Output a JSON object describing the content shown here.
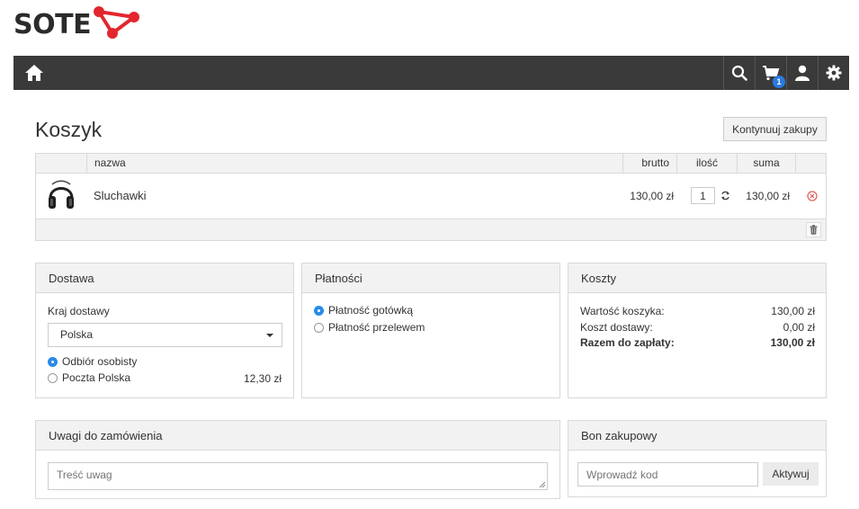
{
  "brand": {
    "name": "SOTE",
    "accent": "#e3262e"
  },
  "nav": {
    "home_icon": "home-icon",
    "search_icon": "search-icon",
    "cart_icon": "cart-icon",
    "cart_count": "1",
    "user_icon": "user-icon",
    "settings_icon": "gear-icon",
    "bg": "#3a3a3a"
  },
  "page": {
    "title": "Koszyk",
    "continue_label": "Kontynuuj zakupy"
  },
  "cart": {
    "columns": {
      "name": "nazwa",
      "brutto": "brutto",
      "qty": "ilość",
      "sum": "suma"
    },
    "items": [
      {
        "icon": "headphones-icon",
        "name": "Sluchawki",
        "brutto": "130,00 zł",
        "qty": "1",
        "sum": "130,00 zł"
      }
    ]
  },
  "delivery": {
    "title": "Dostawa",
    "country_label": "Kraj dostawy",
    "country_value": "Polska",
    "options": [
      {
        "label": "Odbiór osobisty",
        "selected": true,
        "price": ""
      },
      {
        "label": "Poczta Polska",
        "selected": false,
        "price": "12,30 zł"
      }
    ]
  },
  "payment": {
    "title": "Płatności",
    "options": [
      {
        "label": "Płatność gotówką",
        "selected": true
      },
      {
        "label": "Płatność przelewem",
        "selected": false
      }
    ]
  },
  "costs": {
    "title": "Koszty",
    "rows": [
      {
        "label": "Wartość koszyka:",
        "value": "130,00 zł"
      },
      {
        "label": "Koszt dostawy:",
        "value": "0,00 zł"
      },
      {
        "label": "Razem do zapłaty:",
        "value": "130,00 zł"
      }
    ]
  },
  "notes": {
    "title": "Uwagi do zamówienia",
    "placeholder": "Treść uwag"
  },
  "voucher": {
    "title": "Bon zakupowy",
    "placeholder": "Wprowadź kod",
    "button_label": "Aktywuj"
  }
}
